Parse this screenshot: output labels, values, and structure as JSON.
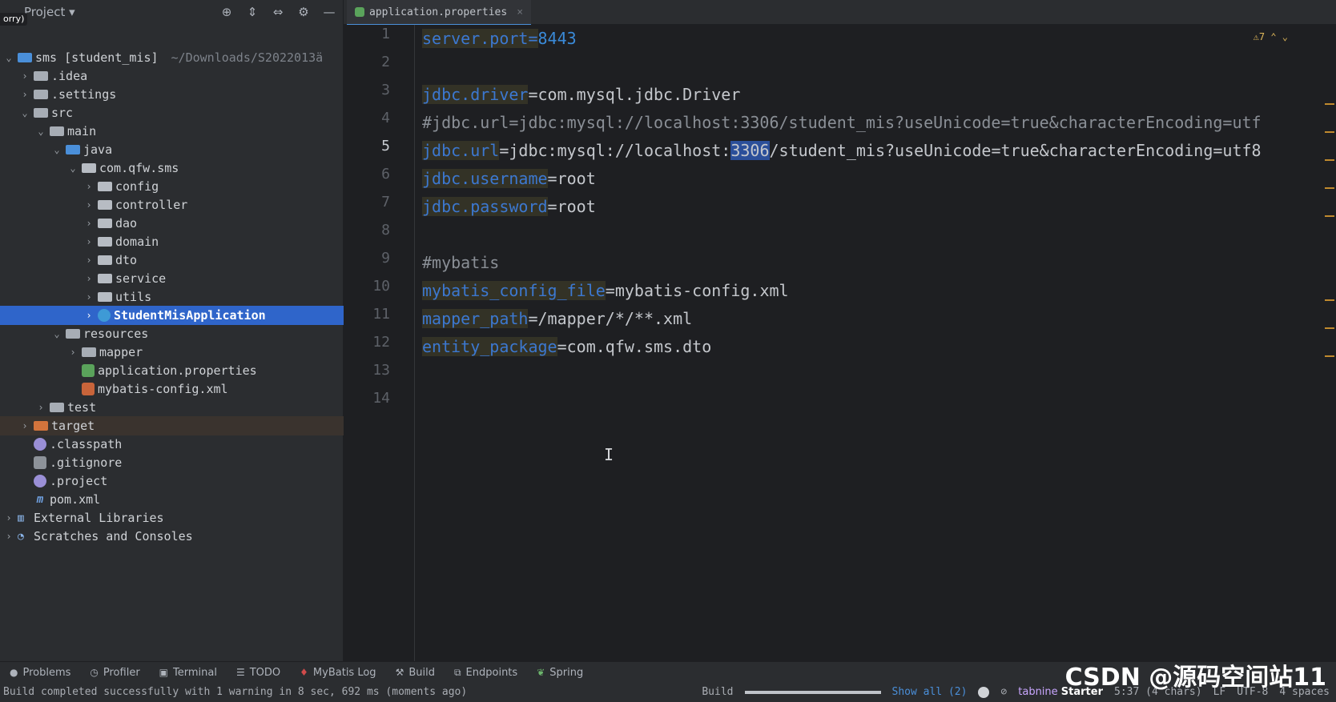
{
  "sidebar": {
    "header_title": "Project",
    "tooltip_chip": "orry)",
    "rows": [
      {
        "label": "sms [student_mis]",
        "extra": "~/Downloads/S2022013ä"
      },
      {
        "label": ".idea"
      },
      {
        "label": ".settings"
      },
      {
        "label": "src"
      },
      {
        "label": "main"
      },
      {
        "label": "java"
      },
      {
        "label": "com.qfw.sms"
      },
      {
        "label": "config"
      },
      {
        "label": "controller"
      },
      {
        "label": "dao"
      },
      {
        "label": "domain"
      },
      {
        "label": "dto"
      },
      {
        "label": "service"
      },
      {
        "label": "utils"
      },
      {
        "label": "StudentMisApplication"
      },
      {
        "label": "resources"
      },
      {
        "label": "mapper"
      },
      {
        "label": "application.properties"
      },
      {
        "label": "mybatis-config.xml"
      },
      {
        "label": "test"
      },
      {
        "label": "target"
      },
      {
        "label": ".classpath"
      },
      {
        "label": ".gitignore"
      },
      {
        "label": ".project"
      },
      {
        "label": "pom.xml"
      },
      {
        "label": "External Libraries"
      },
      {
        "label": "Scratches and Consoles"
      }
    ]
  },
  "editor": {
    "tab_label": "application.properties",
    "warning_count": "⚠7",
    "line_numbers": [
      "1",
      "2",
      "3",
      "4",
      "5",
      "6",
      "7",
      "8",
      "9",
      "10",
      "11",
      "12",
      "13",
      "14"
    ],
    "lines": {
      "l1": {
        "key": "server.port",
        "eq": "=",
        "val": "8443"
      },
      "l3": {
        "key": "jdbc.driver",
        "eq": "=",
        "val": "com.mysql.jdbc.Driver"
      },
      "l4": {
        "text": "#jdbc.url=jdbc:mysql://localhost:3306/student_mis?useUnicode=true&characterEncoding=utf"
      },
      "l5": {
        "key": "jdbc.url",
        "eq": "=",
        "val_a": "jdbc:mysql://localhost:",
        "val_hl": "3306",
        "val_b": "/student_mis?useUnicode=true&characterEncoding=utf8"
      },
      "l6": {
        "key": "jdbc.username",
        "eq": "=",
        "val": "root"
      },
      "l7": {
        "key": "jdbc.password",
        "eq": "=",
        "val": "root"
      },
      "l9": {
        "text": "#mybatis"
      },
      "l10": {
        "key": "mybatis_config_file",
        "eq": "=",
        "val": "mybatis-config.xml"
      },
      "l11": {
        "key": "mapper_path",
        "eq": "=",
        "val": "/mapper/*/**.xml"
      },
      "l12": {
        "key": "entity_package",
        "eq": "=",
        "val": "com.qfw.sms.dto"
      }
    }
  },
  "toolwindows": [
    "Problems",
    "Profiler",
    "Terminal",
    "TODO",
    "MyBatis Log",
    "Build",
    "Endpoints",
    "Spring"
  ],
  "status": {
    "message": "Build completed successfully with 1 warning in 8 sec, 692 ms (moments ago)",
    "build_label": "Build",
    "build_progress": 1.0,
    "show_all": "Show all (2)",
    "tabnine": "tabnine",
    "tabnine_plan": "Starter",
    "position": "5:37 (4 chars)",
    "line_sep": "LF",
    "encoding": "UTF-8",
    "indent": "4 spaces"
  },
  "watermark": "CSDN @源码空间站11",
  "colors": {
    "accent": "#2f65ca",
    "key": "#3c78d0",
    "number": "#3a8ad8"
  }
}
